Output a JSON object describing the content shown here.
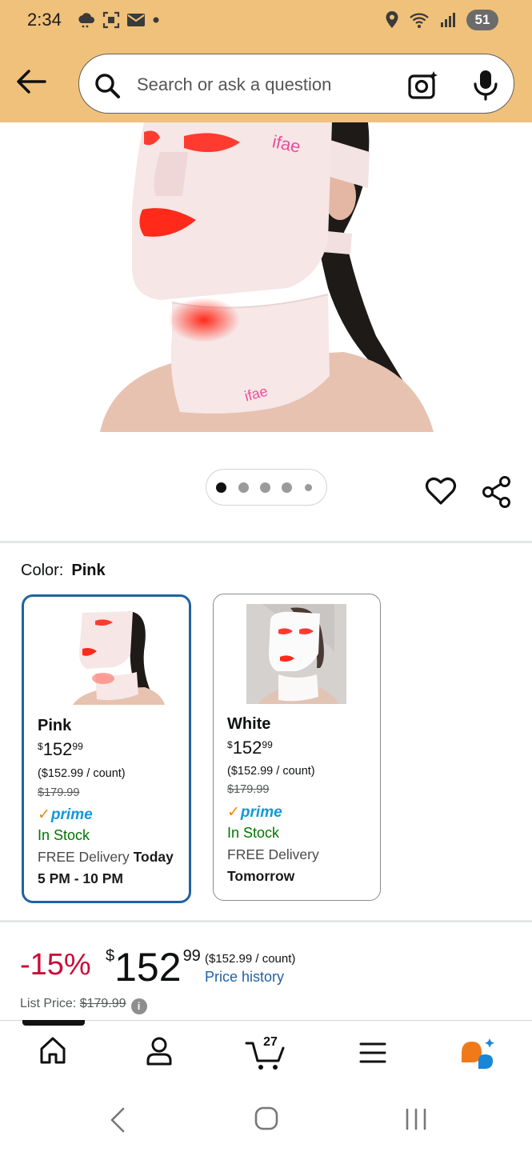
{
  "status_bar": {
    "time": "2:34",
    "battery": "51"
  },
  "search": {
    "placeholder": "Search or ask a question"
  },
  "product": {
    "hero_brand_text": "ifae",
    "carousel": {
      "count": 5,
      "active_index": 0
    },
    "color_label": "Color:",
    "selected_color": "Pink",
    "variants": [
      {
        "name": "Pink",
        "price_symbol": "$",
        "price_whole": "152",
        "price_cents": "99",
        "unit_price": "($152.99 / count)",
        "list_price": "$179.99",
        "prime_label": "prime",
        "stock": "In Stock",
        "delivery_prefix": "FREE Delivery",
        "delivery_day": "Today",
        "delivery_window": "5 PM - 10 PM",
        "selected": true
      },
      {
        "name": "White",
        "price_symbol": "$",
        "price_whole": "152",
        "price_cents": "99",
        "unit_price": "($152.99 / count)",
        "list_price": "$179.99",
        "prime_label": "prime",
        "stock": "In Stock",
        "delivery_prefix": "FREE Delivery",
        "delivery_day": "Tomorrow",
        "selected": false
      }
    ],
    "price_block": {
      "discount": "-15%",
      "price_symbol": "$",
      "price_whole": "152",
      "price_cents": "99",
      "unit_price": "($152.99 / count)",
      "price_history_link": "Price history",
      "list_price_label": "List Price:",
      "list_price": "$179.99",
      "info_icon": "i"
    }
  },
  "bottom_nav": {
    "items": [
      "home-icon",
      "account-icon",
      "cart-icon",
      "menu-icon",
      "rufus-ai-icon"
    ],
    "cart_count": "27"
  },
  "colors": {
    "header_bg": "#f0c17a",
    "selected_border": "#2162a1",
    "discount_red": "#cc0c39",
    "stock_green": "#007600",
    "link_blue": "#2162a1",
    "prime_blue": "#1399d8",
    "prime_check": "#f08804"
  }
}
